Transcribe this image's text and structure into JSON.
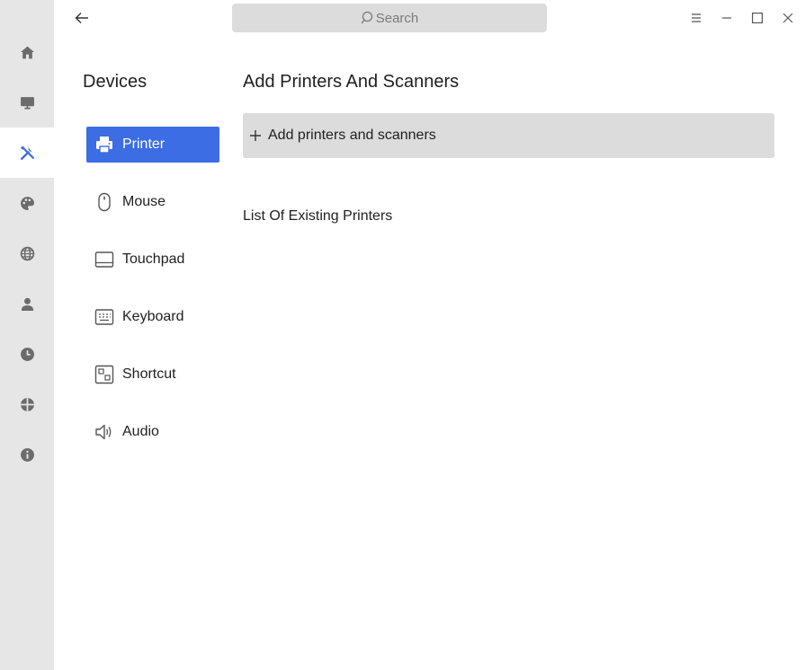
{
  "rail": {
    "items": [
      {
        "icon": "home-icon"
      },
      {
        "icon": "monitor-icon"
      },
      {
        "icon": "tools-icon",
        "active": true
      },
      {
        "icon": "palette-icon"
      },
      {
        "icon": "globe-icon"
      },
      {
        "icon": "user-icon"
      },
      {
        "icon": "clock-icon"
      },
      {
        "icon": "update-icon"
      },
      {
        "icon": "info-icon"
      }
    ],
    "active_color": "#3c6de4"
  },
  "header": {
    "search_placeholder": "Search"
  },
  "devices": {
    "title": "Devices",
    "items": [
      {
        "label": "Printer",
        "icon": "printer-icon",
        "active": true
      },
      {
        "label": "Mouse",
        "icon": "mouse-icon"
      },
      {
        "label": "Touchpad",
        "icon": "touchpad-icon"
      },
      {
        "label": "Keyboard",
        "icon": "keyboard-icon"
      },
      {
        "label": "Shortcut",
        "icon": "shortcut-icon"
      },
      {
        "label": "Audio",
        "icon": "speaker-icon"
      }
    ]
  },
  "main": {
    "title": "Add Printers And Scanners",
    "add_button_label": "Add printers and scanners",
    "list_title": "List Of Existing Printers"
  },
  "colors": {
    "accent": "#3c6de4",
    "rail_bg": "#e6e6e6",
    "button_bg": "#dcdcdc"
  }
}
